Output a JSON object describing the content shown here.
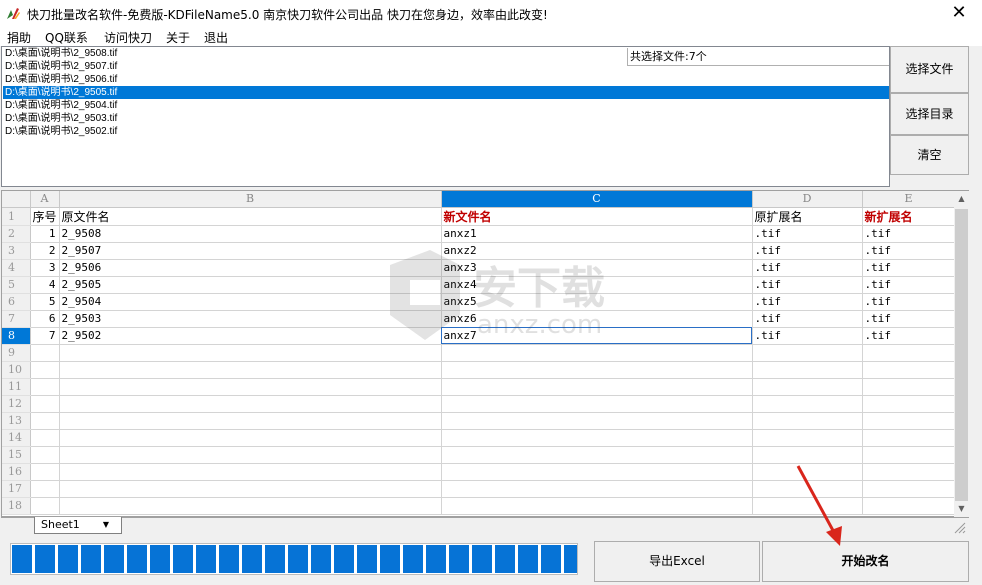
{
  "window": {
    "title": "快刀批量改名软件-免费版-KDFileName5.0      南京快刀软件公司出品   快刀在您身边，效率由此改变!",
    "close_symbol": "✕"
  },
  "menu": [
    "捐助",
    "QQ联系",
    "访问快刀",
    "关于",
    "退出"
  ],
  "file_list": {
    "items": [
      "D:\\桌面\\说明书\\2_9508.tif",
      "D:\\桌面\\说明书\\2_9507.tif",
      "D:\\桌面\\说明书\\2_9506.tif",
      "D:\\桌面\\说明书\\2_9505.tif",
      "D:\\桌面\\说明书\\2_9504.tif",
      "D:\\桌面\\说明书\\2_9503.tif",
      "D:\\桌面\\说明书\\2_9502.tif"
    ],
    "selected_index": 3,
    "count_text": "共选择文件:7个"
  },
  "side_buttons": {
    "select_files": "选择文件",
    "select_dir": "选择目录",
    "clear": "清空"
  },
  "grid": {
    "column_letters": [
      "A",
      "B",
      "C",
      "D",
      "E"
    ],
    "active_column": "C",
    "active_row": 8,
    "header": {
      "seq": "序号",
      "orig_name": "原文件名",
      "new_name": "新文件名",
      "orig_ext": "原扩展名",
      "new_ext": "新扩展名"
    },
    "rows": [
      {
        "seq": "1",
        "orig": "2_9508",
        "new": "anxz1",
        "ext": ".tif",
        "newext": ".tif"
      },
      {
        "seq": "2",
        "orig": "2_9507",
        "new": "anxz2",
        "ext": ".tif",
        "newext": ".tif"
      },
      {
        "seq": "3",
        "orig": "2_9506",
        "new": "anxz3",
        "ext": ".tif",
        "newext": ".tif"
      },
      {
        "seq": "4",
        "orig": "2_9505",
        "new": "anxz4",
        "ext": ".tif",
        "newext": ".tif"
      },
      {
        "seq": "5",
        "orig": "2_9504",
        "new": "anxz5",
        "ext": ".tif",
        "newext": ".tif"
      },
      {
        "seq": "6",
        "orig": "2_9503",
        "new": "anxz6",
        "ext": ".tif",
        "newext": ".tif"
      },
      {
        "seq": "7",
        "orig": "2_9502",
        "new": "anxz7",
        "ext": ".tif",
        "newext": ".tif"
      }
    ],
    "row_numbers": [
      "1",
      "2",
      "3",
      "4",
      "5",
      "6",
      "7",
      "8",
      "9",
      "10",
      "11",
      "12",
      "13",
      "14",
      "15",
      "16",
      "17",
      "18"
    ],
    "sheet_tab": "Sheet1"
  },
  "progress": {
    "value": 1.0
  },
  "bottom_buttons": {
    "export": "导出Excel",
    "start": "开始改名"
  },
  "colors": {
    "accent": "#0078d7",
    "progress": "#0673d6",
    "header_red": "#c00000",
    "arrow_red": "#d9261c"
  },
  "watermark": {
    "text": "安下载",
    "sub": "anxz.com"
  }
}
